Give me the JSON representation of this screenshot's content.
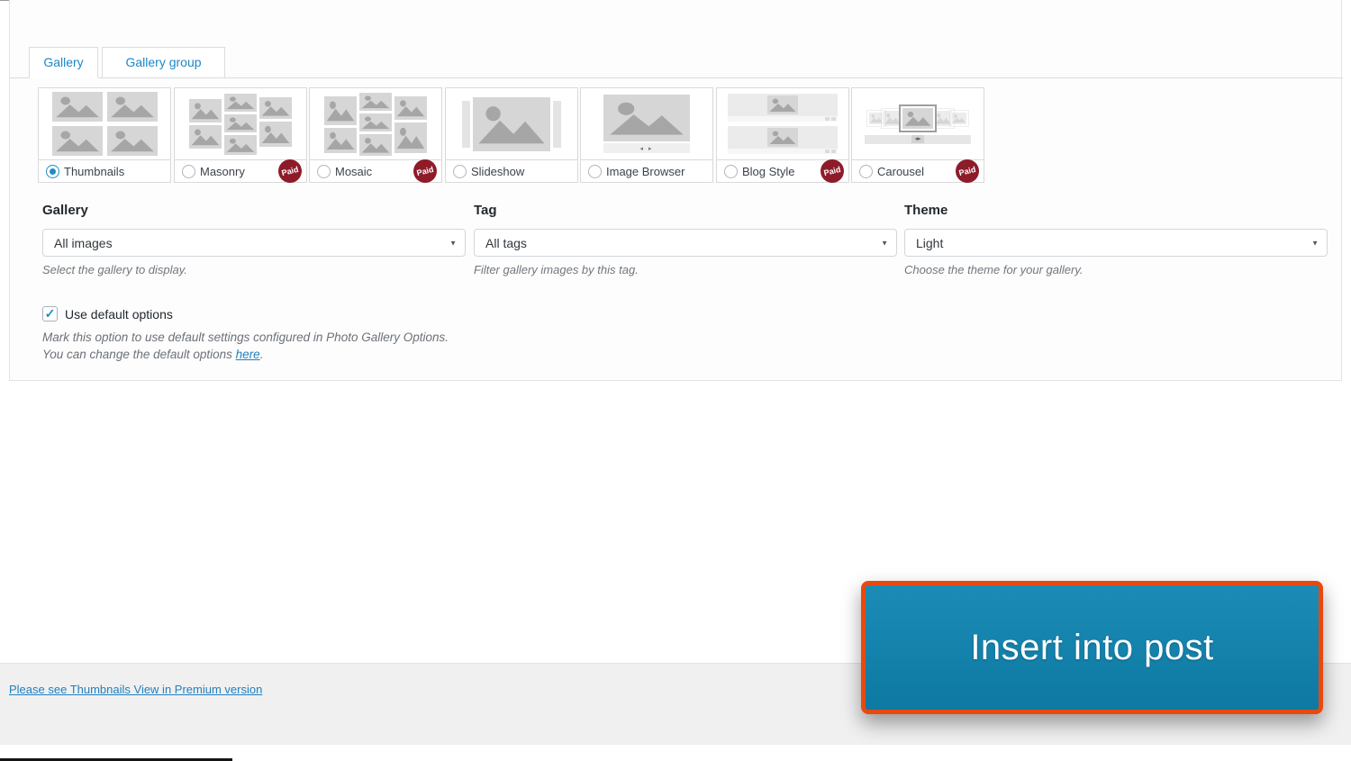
{
  "dialog": {
    "tabs": [
      {
        "label": "Gallery",
        "active": true
      },
      {
        "label": "Gallery group",
        "active": false
      }
    ],
    "paid_badge_label": "Paid",
    "view_types": [
      {
        "label": "Thumbnails",
        "selected": true,
        "paid": false
      },
      {
        "label": "Masonry",
        "selected": false,
        "paid": true
      },
      {
        "label": "Mosaic",
        "selected": false,
        "paid": true
      },
      {
        "label": "Slideshow",
        "selected": false,
        "paid": false
      },
      {
        "label": "Image Browser",
        "selected": false,
        "paid": false
      },
      {
        "label": "Blog Style",
        "selected": false,
        "paid": true
      },
      {
        "label": "Carousel",
        "selected": false,
        "paid": true
      }
    ],
    "fields": [
      {
        "label": "Gallery",
        "value": "All images",
        "help": "Select the gallery to display."
      },
      {
        "label": "Tag",
        "value": "All tags",
        "help": "Filter gallery images by this tag."
      },
      {
        "label": "Theme",
        "value": "Light",
        "help": "Choose the theme for your gallery."
      }
    ],
    "default_options": {
      "label": "Use default options",
      "checked": true,
      "help_line1": "Mark this option to use default settings configured in Photo Gallery Options.",
      "help_line2_prefix": "You can change the default options ",
      "help_link_text": "here",
      "help_line2_suffix": "."
    },
    "footer": {
      "premium_link": "Please see Thumbnails View in Premium version"
    },
    "insert_button": {
      "label": "Insert into post"
    }
  },
  "icons": {
    "close": "✕",
    "select_caret": "▼",
    "checkbox_check": "✓",
    "pager_arrows": "◂ ▸",
    "carousel_arrows": "◂▸"
  },
  "colors": {
    "tab_blue": "#1a87c7",
    "paid_red": "#8e1b29",
    "link_blue": "#2080bf",
    "button_blue": "#1583ad",
    "highlight_orange": "#e8490f",
    "footer_gray": "#f0f0f1"
  }
}
